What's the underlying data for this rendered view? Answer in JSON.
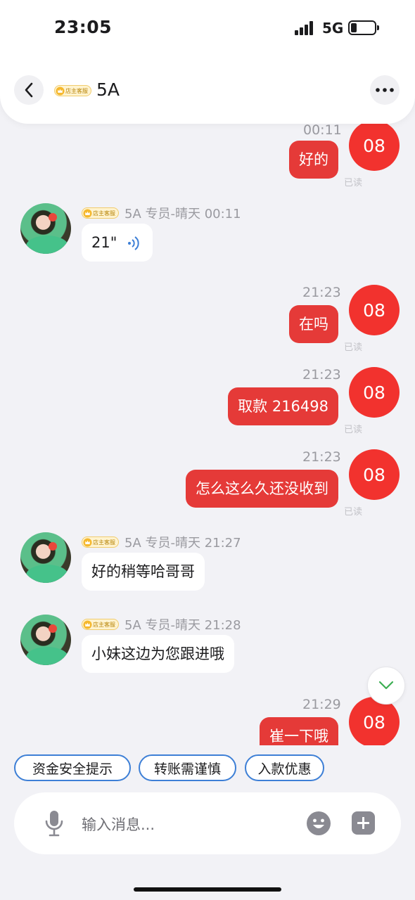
{
  "status_bar": {
    "time": "23:05",
    "network": "5G"
  },
  "header": {
    "badge": "店主客服",
    "title": "5A"
  },
  "badge_text": "店主客服",
  "messages": {
    "m1": {
      "time": "00:11",
      "text": "好的",
      "avatar": "08",
      "read": "已读"
    },
    "m2": {
      "sender": "5A 专员-晴天 00:11",
      "text": "21\""
    },
    "m3": {
      "time": "21:23",
      "text": "在吗",
      "avatar": "08",
      "read": "已读"
    },
    "m4": {
      "time": "21:23",
      "text": "取款 216498",
      "avatar": "08",
      "read": "已读"
    },
    "m5": {
      "time": "21:23",
      "text": "怎么这么久还没收到",
      "avatar": "08",
      "read": "已读"
    },
    "m6": {
      "sender": "5A 专员-晴天 21:27",
      "text": "好的稍等哈哥哥"
    },
    "m7": {
      "sender": "5A 专员-晴天 21:28",
      "text": "小妹这边为您跟进哦"
    },
    "m8": {
      "time": "21:29",
      "text": "崔一下哦",
      "avatar": "08"
    }
  },
  "quick_replies": [
    "资金安全提示",
    "转账需谨慎",
    "入款优惠"
  ],
  "input": {
    "placeholder": "输入消息..."
  },
  "colors": {
    "outgoing": "#e53a38",
    "avatar": "#f2322e",
    "chip_border": "#3d7fd6",
    "background": "#f2f2f6"
  },
  "icons": {
    "back": "chevron-left-icon",
    "more": "more-horizontal-icon",
    "mic": "microphone-icon",
    "emoji": "emoji-icon",
    "plus": "plus-icon",
    "scroll": "chevron-down-icon",
    "voice": "voice-wave-icon"
  }
}
